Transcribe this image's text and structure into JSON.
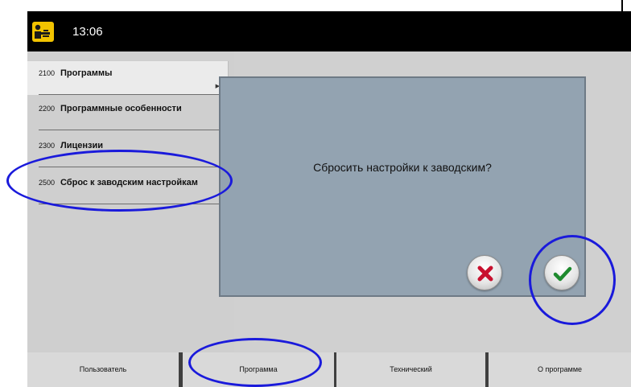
{
  "header": {
    "time": "13:06",
    "logo_icon": "person-pointing-icon"
  },
  "sidebar": {
    "items": [
      {
        "number": "2100",
        "label": "Программы",
        "selected": true
      },
      {
        "number": "2200",
        "label": "Программные особенности"
      },
      {
        "number": "2300",
        "label": "Лицензии"
      },
      {
        "number": "2500",
        "label": "Сброс к заводским настройкам"
      }
    ]
  },
  "dialog": {
    "message": "Сбросить настройки к заводским?",
    "cancel_icon": "red-x-icon",
    "confirm_icon": "green-check-icon"
  },
  "bottom_tabs": [
    {
      "label": "Пользователь"
    },
    {
      "label": "Программа",
      "active": true
    },
    {
      "label": "Технический"
    },
    {
      "label": "О программе"
    }
  ],
  "colors": {
    "annotation": "#1a1adb",
    "dialog_bg": "#93a3b1",
    "topbar": "#000000"
  }
}
